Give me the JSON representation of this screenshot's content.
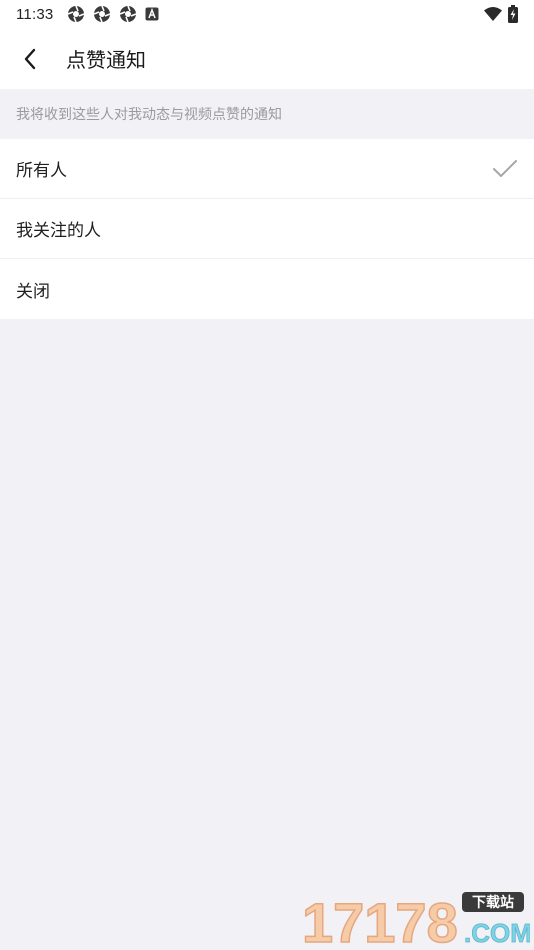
{
  "status_bar": {
    "time": "11:33",
    "notification_icons": [
      "aperture-icon",
      "aperture-icon",
      "aperture-icon",
      "a-box-icon"
    ],
    "right_icons": [
      "wifi-icon",
      "battery-charging-icon"
    ]
  },
  "header": {
    "title": "点赞通知",
    "back_icon": "chevron-left-icon"
  },
  "section": {
    "hint": "我将收到这些人对我动态与视频点赞的通知"
  },
  "options": [
    {
      "label": "所有人",
      "selected": true
    },
    {
      "label": "我关注的人",
      "selected": false
    },
    {
      "label": "关闭",
      "selected": false
    }
  ],
  "watermark": {
    "number": "17178",
    "tag": "下载站",
    "domain": ".COM"
  },
  "colors": {
    "background": "#f2f1f6",
    "surface": "#ffffff",
    "hint_text": "#9a9a9f",
    "check": "#a6a6aa"
  }
}
